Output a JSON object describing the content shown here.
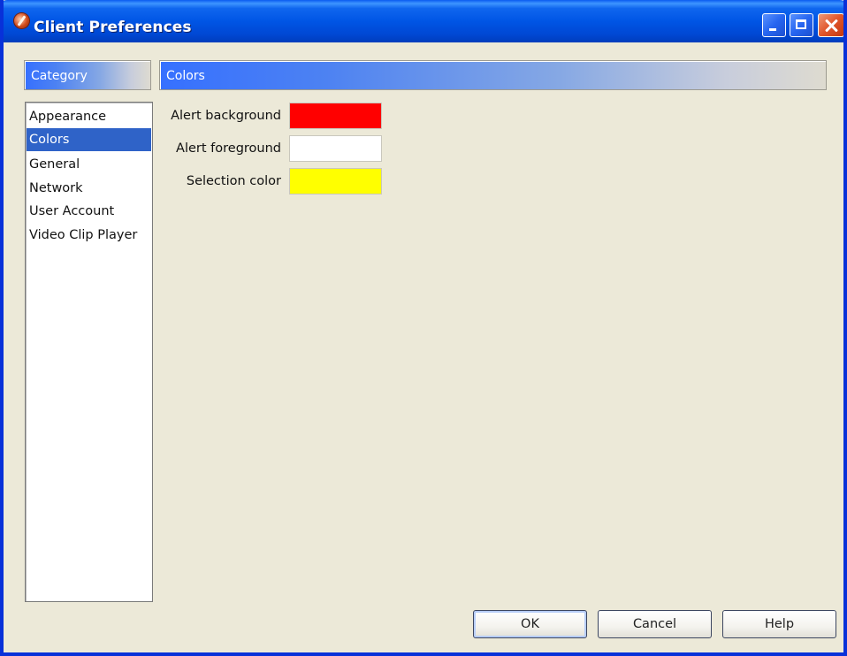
{
  "window": {
    "title": "Client Preferences"
  },
  "category_header": "Category",
  "panel_header": "Colors",
  "categories": [
    {
      "label": "Appearance",
      "selected": false
    },
    {
      "label": "Colors",
      "selected": true
    },
    {
      "label": "General",
      "selected": false
    },
    {
      "label": "Network",
      "selected": false
    },
    {
      "label": "User Account",
      "selected": false
    },
    {
      "label": "Video Clip Player",
      "selected": false
    }
  ],
  "colors": [
    {
      "label": "Alert background",
      "value": "#ff0000"
    },
    {
      "label": "Alert foreground",
      "value": "#ffffff"
    },
    {
      "label": "Selection color",
      "value": "#ffff00"
    }
  ],
  "buttons": {
    "ok": "OK",
    "cancel": "Cancel",
    "help": "Help"
  },
  "theme": {
    "selection_bg": "#2f63c8",
    "window_bg": "#ece9d8"
  }
}
